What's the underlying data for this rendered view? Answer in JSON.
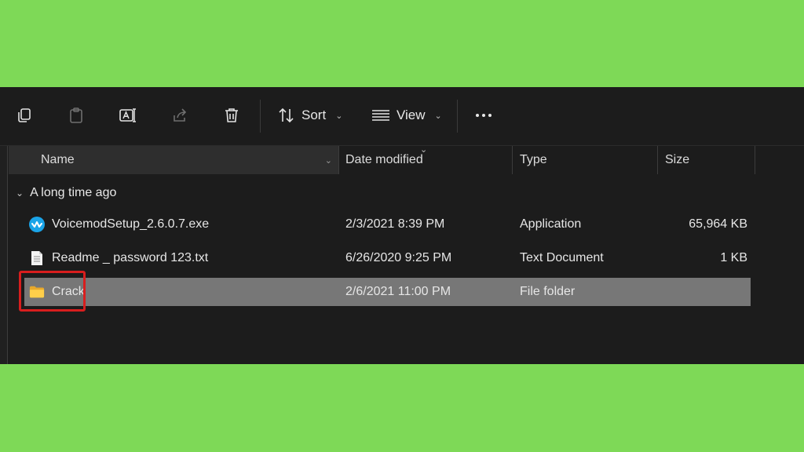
{
  "toolbar": {
    "sort_label": "Sort",
    "view_label": "View"
  },
  "columns": {
    "name": "Name",
    "date": "Date modified",
    "type": "Type",
    "size": "Size"
  },
  "group": {
    "label": "A long time ago"
  },
  "files": [
    {
      "name": "VoicemodSetup_2.6.0.7.exe",
      "date": "2/3/2021 8:39 PM",
      "type": "Application",
      "size": "65,964 KB",
      "icon": "voicemod-app-icon"
    },
    {
      "name": "Readme _ password 123.txt",
      "date": "6/26/2020 9:25 PM",
      "type": "Text Document",
      "size": "1 KB",
      "icon": "text-file-icon"
    },
    {
      "name": "Crack",
      "date": "2/6/2021 11:00 PM",
      "type": "File folder",
      "size": "",
      "icon": "folder-icon",
      "selected": true
    }
  ],
  "colors": {
    "background": "#7ed957",
    "explorer_bg": "#1c1c1c",
    "selected_row": "#777777",
    "annotation": "#d81e1e"
  }
}
